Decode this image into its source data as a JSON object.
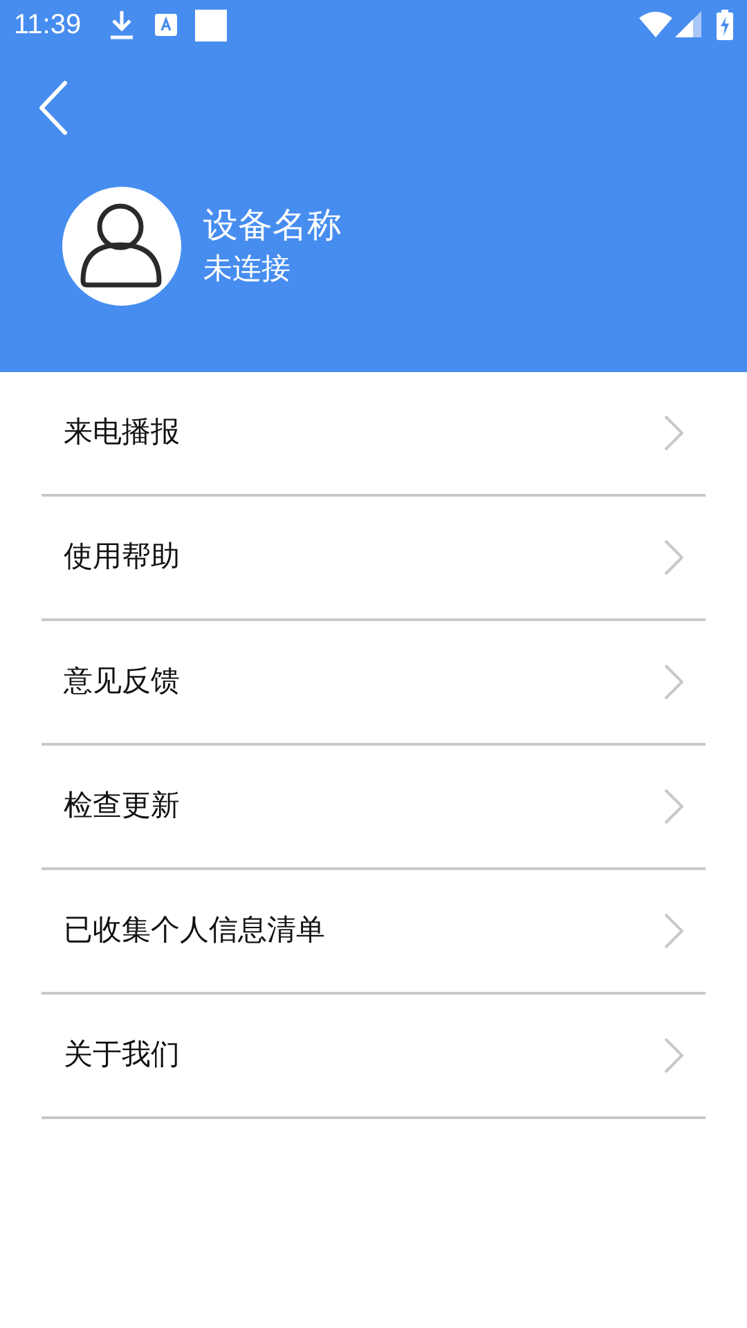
{
  "status_bar": {
    "time": "11:39"
  },
  "header": {
    "device_name": "设备名称",
    "connection_status": "未连接"
  },
  "menu": [
    {
      "label": "来电播报"
    },
    {
      "label": "使用帮助"
    },
    {
      "label": "意见反馈"
    },
    {
      "label": "检查更新"
    },
    {
      "label": "已收集个人信息清单"
    },
    {
      "label": "关于我们"
    }
  ]
}
